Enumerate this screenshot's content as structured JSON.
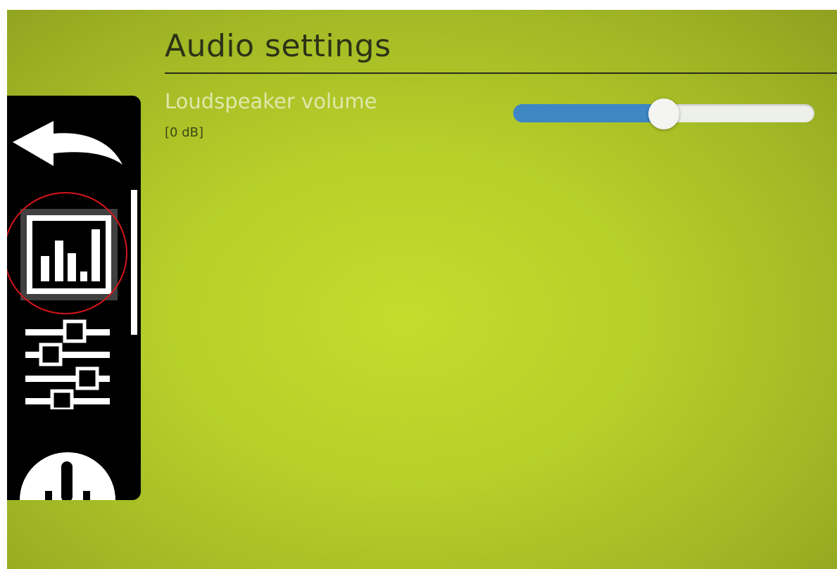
{
  "page": {
    "title": "Audio settings"
  },
  "volume": {
    "label": "Loudspeaker volume",
    "value_text": "[0 dB]",
    "level": 0.5
  },
  "sidebar": {
    "items": [
      {
        "name": "back",
        "icon": "back-arrow-icon"
      },
      {
        "name": "audio-levels",
        "icon": "bar-chart-icon",
        "selected": true
      },
      {
        "name": "equalizer",
        "icon": "equalizer-sliders-icon"
      },
      {
        "name": "gauge",
        "icon": "gauge-icon"
      }
    ]
  },
  "colors": {
    "background": "#b7d02a",
    "sidebar": "#000000",
    "slider_fill": "#3f86c4",
    "highlight": "#d8151b"
  }
}
